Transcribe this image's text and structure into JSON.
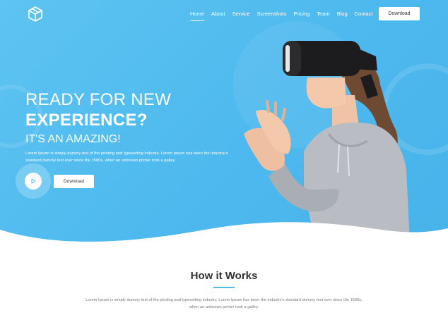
{
  "nav": {
    "items": [
      {
        "label": "Home",
        "active": true
      },
      {
        "label": "About"
      },
      {
        "label": "Service"
      },
      {
        "label": "Screenshots"
      },
      {
        "label": "Pricing"
      },
      {
        "label": "Team"
      },
      {
        "label": "Blog"
      },
      {
        "label": "Contact"
      }
    ],
    "download_label": "Download"
  },
  "hero": {
    "line1": "READY FOR NEW",
    "line2": "EXPERIENCE?",
    "line3": "IT'S AN AMAZING!",
    "description": "Lorem Ipsum is simply dummy text of the printing and typesetting industry. Lorem Ipsum has been the industry's standard dummy text ever since the 1500s, when an unknown printer took a galley.",
    "download_label": "Download"
  },
  "how": {
    "title": "How it Works",
    "description": "Lorem Ipsum is simply dummy text of the printing and typesetting industry. Lorem Ipsum has been the industry's standard dummy text ever since the 1500s, when an unknown printer took a galley."
  },
  "colors": {
    "accent": "#4db9ee",
    "hero_gradient_start": "#5ec4f1",
    "hero_gradient_end": "#47b3ea",
    "heading": "#333333",
    "body_text": "#777777"
  },
  "icons": {
    "logo": "cube-logo-icon",
    "play": "play-icon"
  }
}
